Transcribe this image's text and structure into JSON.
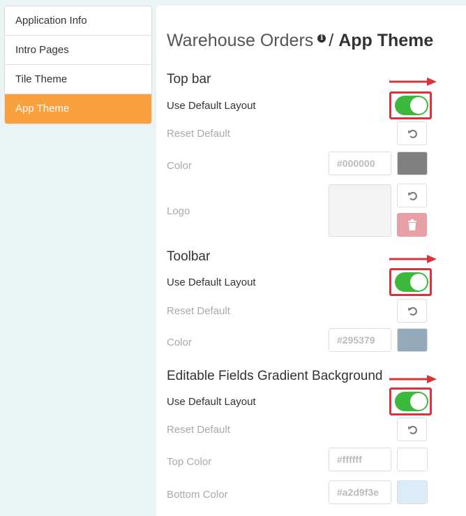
{
  "sidebar": {
    "items": [
      {
        "label": "Application Info"
      },
      {
        "label": "Intro Pages"
      },
      {
        "label": "Tile Theme"
      },
      {
        "label": "App Theme"
      }
    ]
  },
  "breadcrumb": {
    "app": "Warehouse Orders",
    "separator": "/",
    "current": "App Theme"
  },
  "sections": {
    "top_bar": {
      "title": "Top bar",
      "use_default_label": "Use Default Layout",
      "use_default_on": true,
      "reset_label": "Reset Default",
      "color_label": "Color",
      "color_value": "#000000",
      "swatch_color": "#808080",
      "logo_label": "Logo"
    },
    "toolbar": {
      "title": "Toolbar",
      "use_default_label": "Use Default Layout",
      "use_default_on": true,
      "reset_label": "Reset Default",
      "color_label": "Color",
      "color_value": "#295379",
      "swatch_color": "#94a9ba"
    },
    "gradient": {
      "title": "Editable Fields Gradient Background",
      "use_default_label": "Use Default Layout",
      "use_default_on": true,
      "reset_label": "Reset Default",
      "top_color_label": "Top Color",
      "top_color_value": "#ffffff",
      "top_swatch_color": "#ffffff",
      "bottom_color_label": "Bottom Color",
      "bottom_color_value": "#a2d9f3e",
      "bottom_swatch_color": "#d9ecf7"
    }
  },
  "colors": {
    "accent": "#f9a03f",
    "toggle_on": "#3cb93c",
    "highlight": "#d9323a"
  }
}
